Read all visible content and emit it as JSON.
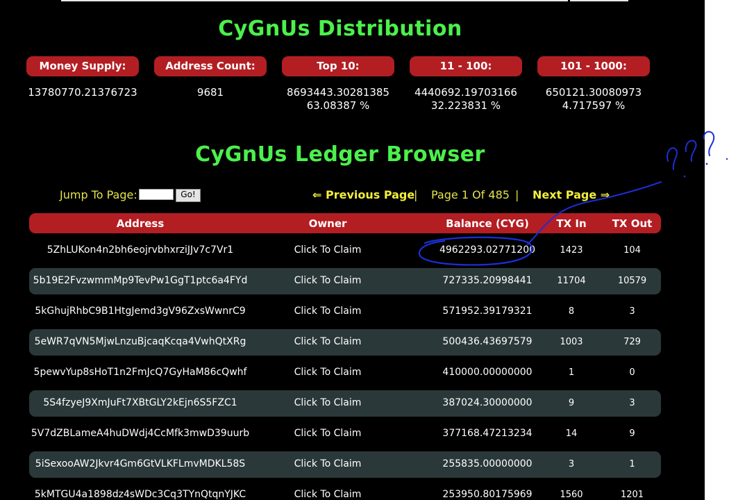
{
  "distribution": {
    "title": "CyGnUs Distribution",
    "stats": [
      {
        "label": "Money Supply:",
        "value": "13780770.21376723",
        "percent": ""
      },
      {
        "label": "Address Count:",
        "value": "9681",
        "percent": ""
      },
      {
        "label": "Top 10:",
        "value": "8693443.30281385",
        "percent": "63.08387 %"
      },
      {
        "label": "11 - 100:",
        "value": "4440692.19703166",
        "percent": "32.223831 %"
      },
      {
        "label": "101 - 1000:",
        "value": "650121.30080973",
        "percent": "4.717597 %"
      }
    ]
  },
  "ledger": {
    "title": "CyGnUs Ledger Browser",
    "jump_label": "Jump To Page:",
    "go_label": "Go!",
    "prev_label": "⇐ Previous Page",
    "separator": "|",
    "page_info": "Page 1 Of 485",
    "next_label": "Next Page ⇒"
  },
  "table": {
    "headers": [
      "Address",
      "Owner",
      "Balance (CYG)",
      "TX In",
      "TX Out"
    ],
    "rows": [
      {
        "address": "5ZhLUKon4n2bh6eojrvbhxrziJJv7c7Vr1",
        "owner": "Click To Claim",
        "balance": "4962293.02771200",
        "tx_in": "1423",
        "tx_out": "104"
      },
      {
        "address": "5b19E2FvzwmmMp9TevPw1GgT1ptc6a4FYd",
        "owner": "Click To Claim",
        "balance": "727335.20998441",
        "tx_in": "11704",
        "tx_out": "10579"
      },
      {
        "address": "5kGhujRhbC9B1HtgJemd3gV96ZxsWwnrC9",
        "owner": "Click To Claim",
        "balance": "571952.39179321",
        "tx_in": "8",
        "tx_out": "3"
      },
      {
        "address": "5eWR7qVN5MjwLnzuBjcaqKcqa4VwhQtXRg",
        "owner": "Click To Claim",
        "balance": "500436.43697579",
        "tx_in": "1003",
        "tx_out": "729"
      },
      {
        "address": "5pewvYup8sHoT1n2FmJcQ7GyHaM86cQwhf",
        "owner": "Click To Claim",
        "balance": "410000.00000000",
        "tx_in": "1",
        "tx_out": "0"
      },
      {
        "address": "5S4fzyeJ9XmJuFt7XBtGLY2kEjn6S5FZC1",
        "owner": "Click To Claim",
        "balance": "387024.30000000",
        "tx_in": "9",
        "tx_out": "3"
      },
      {
        "address": "5V7dZBLameA4huDWdj4CcMfk3mwD39uurb",
        "owner": "Click To Claim",
        "balance": "377168.47213234",
        "tx_in": "14",
        "tx_out": "9"
      },
      {
        "address": "5iSexooAW2Jkvr4Gm6GtVLKFLmvMDKL58S",
        "owner": "Click To Claim",
        "balance": "255835.00000000",
        "tx_in": "3",
        "tx_out": "1"
      },
      {
        "address": "5kMTGU4a1898dz4sWDc3Cq3TYnQtqnYJKC",
        "owner": "Click To Claim",
        "balance": "253950.80175969",
        "tx_in": "1560",
        "tx_out": "1201"
      }
    ]
  },
  "colors": {
    "background": "#000000",
    "title_green": "#4cf04c",
    "pill_red": "#b31e23",
    "pager_yellow": "#e6e24a",
    "row_alt": "#2b3839",
    "annotation_blue": "#1a2fd6"
  },
  "annotation": {
    "handwritten_text": "???"
  }
}
